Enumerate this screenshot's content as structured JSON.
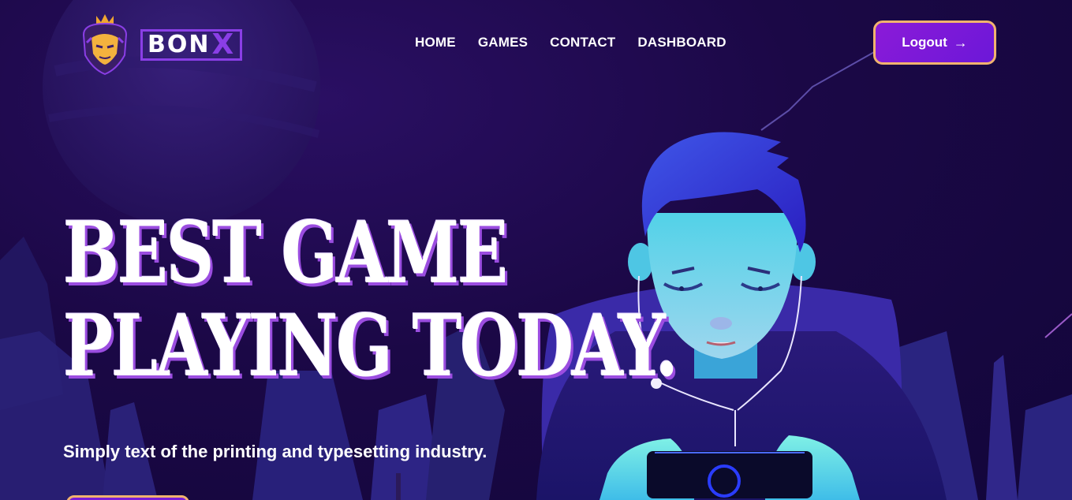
{
  "brand": {
    "name": "BON",
    "name_accent": "X"
  },
  "nav": {
    "items": [
      {
        "label": "HOME"
      },
      {
        "label": "GAMES"
      },
      {
        "label": "CONTACT"
      },
      {
        "label": "DASHBOARD"
      }
    ]
  },
  "header": {
    "logout_label": "Logout",
    "logout_icon": "arrow-right-icon"
  },
  "hero": {
    "title_line1": "BEST GAME",
    "title_line2": "PLAYING TODAY.",
    "subtitle": "Simply text of the printing and typesetting industry."
  },
  "colors": {
    "background": "#1b0846",
    "accent": "#8a3ee6",
    "button_border": "#f1b36e",
    "button_fill": "#7a1cd8"
  }
}
